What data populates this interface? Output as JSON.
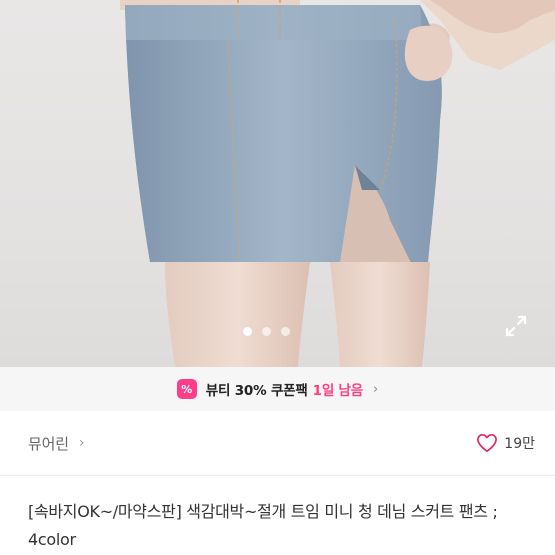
{
  "gallery": {
    "image_alt": "product-photo-denim-mini-skirt",
    "dots": [
      true,
      false,
      false
    ],
    "expand_icon": "expand-icon"
  },
  "coupon": {
    "icon_glyph": "%",
    "text": "뷰티 30% 쿠폰팩",
    "highlight": "1일 남음",
    "chevron": "›",
    "accent": "#ff3d8b"
  },
  "seller": {
    "name": "뮤어린",
    "chevron": "›",
    "likes": "19만"
  },
  "product": {
    "title": "[속바지OK~/마약스판] 색감대박~절개 트임 미니 청 데님 스커트 팬츠 ; 4color"
  }
}
